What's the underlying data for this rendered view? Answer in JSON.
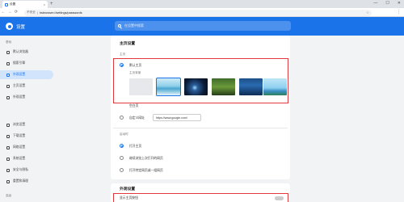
{
  "browser": {
    "tab_title": "设置",
    "tab_close": "×",
    "new_tab": "+",
    "window_controls": [
      "—",
      "☐",
      "✕"
    ],
    "security_label": "不安全",
    "url": "hsbrowser://settings/passwords",
    "back": "←",
    "forward": "→",
    "reload": "⟳"
  },
  "header": {
    "title": "设置",
    "search_placeholder": "在设置中搜索"
  },
  "sidebar": {
    "groups": [
      "基础",
      "高级"
    ],
    "items": [
      {
        "label": "默认浏览器"
      },
      {
        "label": "搜索引擎"
      },
      {
        "label": "外观设置"
      },
      {
        "label": "主页设置"
      },
      {
        "label": "外观设置"
      },
      {
        "label": "浏览设置"
      },
      {
        "label": "下载设置"
      },
      {
        "label": "网络设置"
      },
      {
        "label": "系统设置"
      },
      {
        "label": "安全与隐私"
      },
      {
        "label": "重置和清理"
      }
    ],
    "active_index": 2
  },
  "main": {
    "section_home": "主页设置",
    "home_label": "主页",
    "option_custom_home": "默认主页",
    "wallpaper_label": "主页背景",
    "option_blank": "空白页",
    "option_custom_url": "自定义网址",
    "custom_url_value": "https://www.google.com/",
    "startup_label": "启动时",
    "startup_options": [
      "打开主页",
      "继续浏览上次打开的网页",
      "打开特定网页或一组网页"
    ],
    "section_appearance": "外观设置",
    "appearance_option": "显示主页按钮"
  },
  "colors": {
    "accent": "#1a73e8",
    "highlight_border": "#e0393e"
  }
}
